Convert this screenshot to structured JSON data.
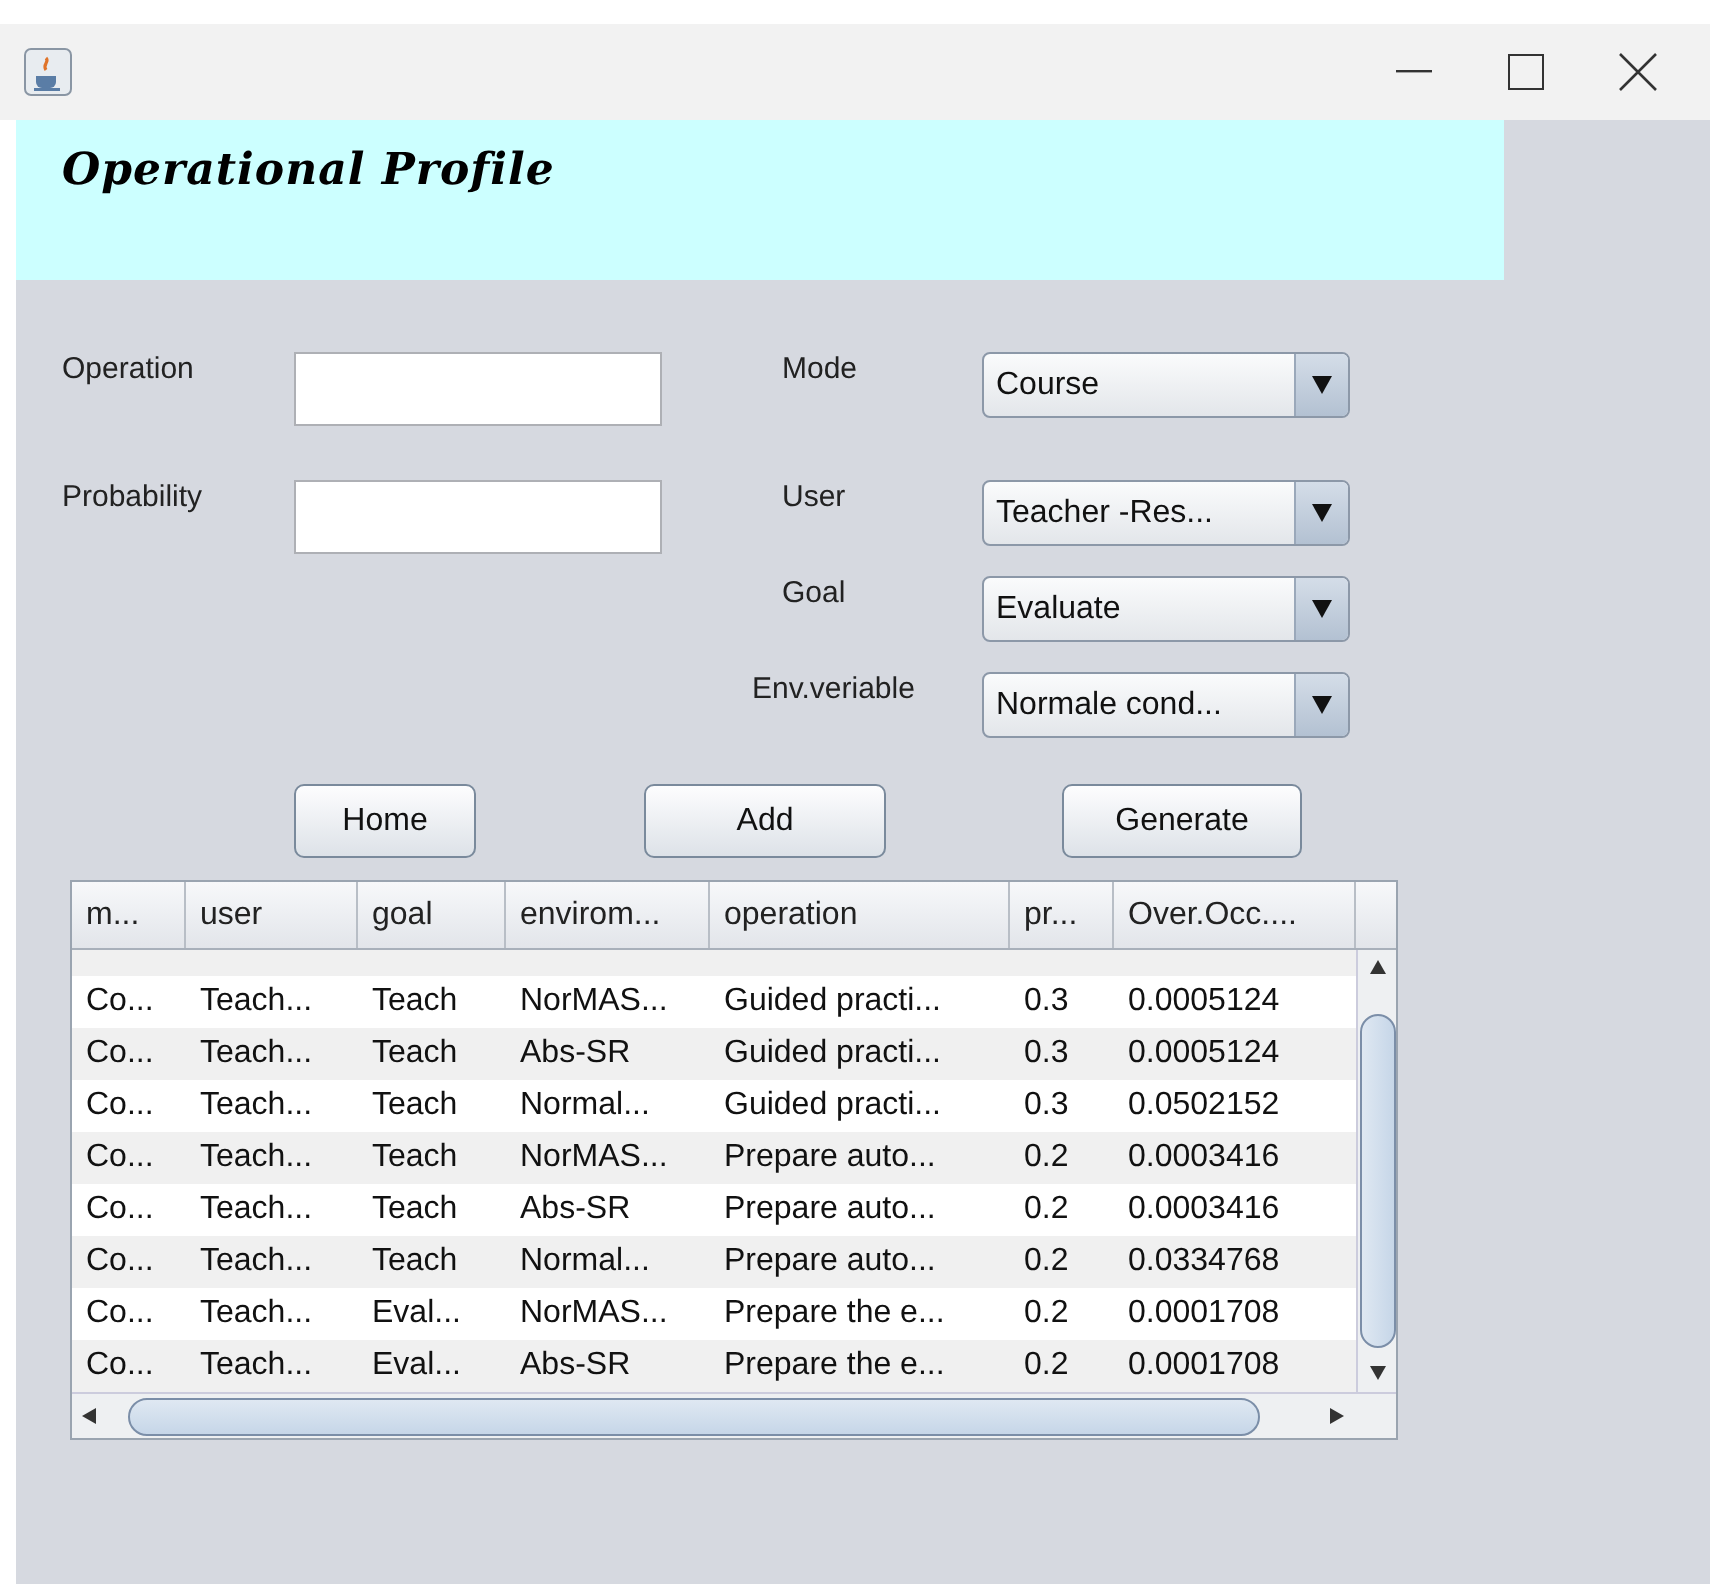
{
  "window": {
    "title": "Operational Profile"
  },
  "form": {
    "fields": [
      {
        "label": "Operation"
      },
      {
        "label": "Probability"
      }
    ],
    "combos": [
      {
        "label": "Mode",
        "value": "Course"
      },
      {
        "label": "User",
        "value": "Teacher -Res..."
      },
      {
        "label": "Goal",
        "value": "Evaluate"
      },
      {
        "label": "Env.veriable",
        "value": "Normale cond..."
      }
    ]
  },
  "buttons": [
    "Home",
    "Add",
    "Generate"
  ],
  "table": {
    "columns": [
      "m...",
      "user",
      "goal",
      "envirom...",
      "operation",
      "pr...",
      "Over.Occ...."
    ],
    "rows": [
      [
        "Co...",
        "Teach...",
        "Teach",
        "NorMAS...",
        "Guided practi...",
        "0.3",
        "0.0005124"
      ],
      [
        "Co...",
        "Teach...",
        "Teach",
        "Abs-SR",
        "Guided practi...",
        "0.3",
        "0.0005124"
      ],
      [
        "Co...",
        "Teach...",
        "Teach",
        "Normal...",
        "Guided practi...",
        "0.3",
        "0.0502152"
      ],
      [
        "Co...",
        "Teach...",
        "Teach",
        "NorMAS...",
        "Prepare auto...",
        "0.2",
        "0.0003416"
      ],
      [
        "Co...",
        "Teach...",
        "Teach",
        "Abs-SR",
        "Prepare auto...",
        "0.2",
        "0.0003416"
      ],
      [
        "Co...",
        "Teach...",
        "Teach",
        "Normal...",
        "Prepare auto...",
        "0.2",
        "0.0334768"
      ],
      [
        "Co...",
        "Teach...",
        "Eval...",
        "NorMAS...",
        "Prepare the e...",
        "0.2",
        "0.0001708"
      ],
      [
        "Co...",
        "Teach...",
        "Eval...",
        "Abs-SR",
        "Prepare the e...",
        "0.2",
        "0.0001708"
      ]
    ]
  }
}
